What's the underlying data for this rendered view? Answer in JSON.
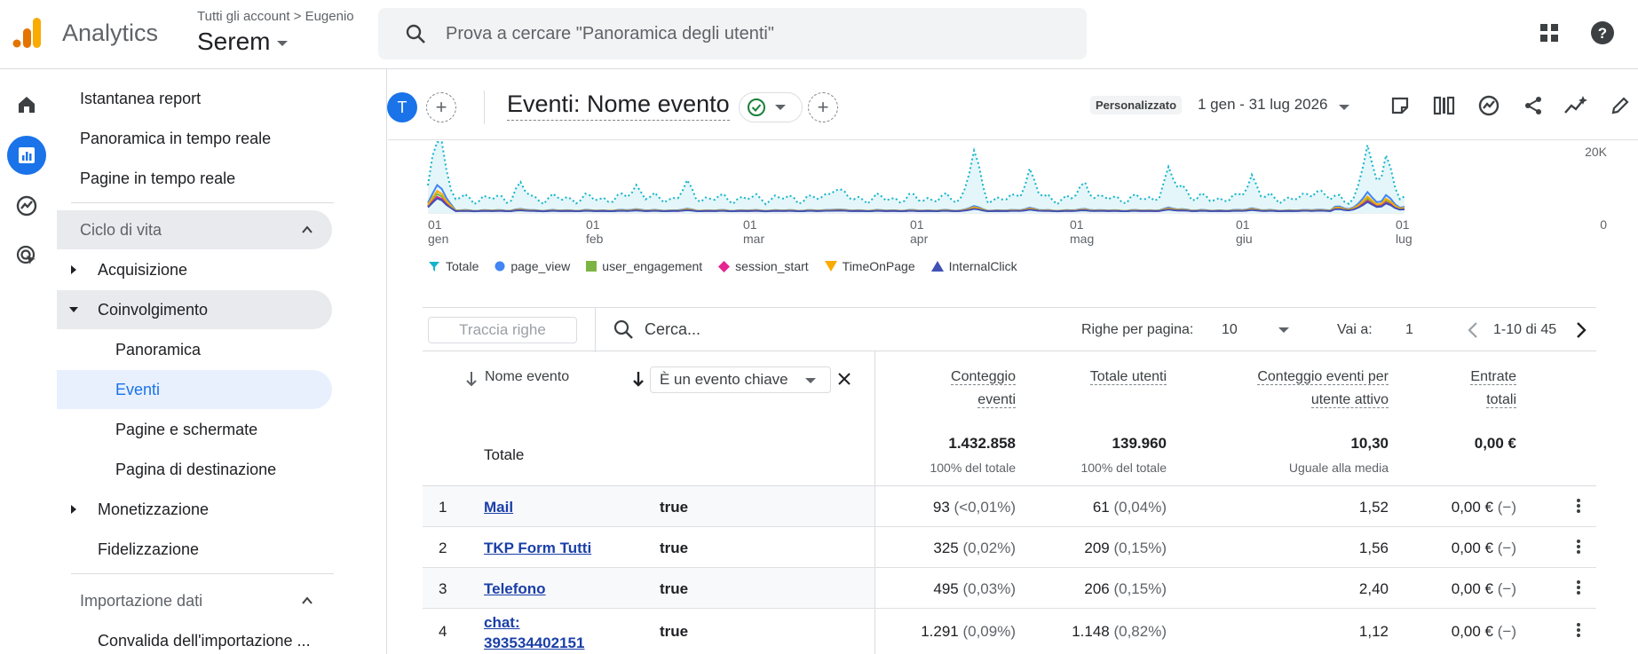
{
  "app": {
    "name": "Analytics"
  },
  "account": {
    "breadcrumb": "Tutti gli account > Eugenio",
    "property": "Serem"
  },
  "search": {
    "placeholder": "Prova a cercare \"Panoramica degli utenti\""
  },
  "sidebar": {
    "items": [
      {
        "label": "Istantanea report"
      },
      {
        "label": "Panoramica in tempo reale"
      },
      {
        "label": "Pagine in tempo reale"
      },
      {
        "label": "Ciclo di vita"
      },
      {
        "label": "Acquisizione"
      },
      {
        "label": "Coinvolgimento"
      },
      {
        "label": "Panoramica"
      },
      {
        "label": "Eventi"
      },
      {
        "label": "Pagine e schermate"
      },
      {
        "label": "Pagina di destinazione"
      },
      {
        "label": "Monetizzazione"
      },
      {
        "label": "Fidelizzazione"
      },
      {
        "label": "Importazione dati"
      },
      {
        "label": "Convalida dell'importazione ..."
      }
    ]
  },
  "report": {
    "avatar": "T",
    "title": "Eventi: Nome evento",
    "date_chip": "Personalizzato",
    "date_range": "1 gen - 31 lug 2026"
  },
  "chart_data": {
    "type": "line",
    "y_ticks": [
      "20K",
      "0"
    ],
    "x_ticks": [
      {
        "day": "01",
        "month": "gen"
      },
      {
        "day": "01",
        "month": "feb"
      },
      {
        "day": "01",
        "month": "mar"
      },
      {
        "day": "01",
        "month": "apr"
      },
      {
        "day": "01",
        "month": "mag"
      },
      {
        "day": "01",
        "month": "giu"
      },
      {
        "day": "01",
        "month": "lug"
      }
    ],
    "legend": [
      {
        "name": "Totale",
        "color": "#12b5cb"
      },
      {
        "name": "page_view",
        "color": "#4285f4"
      },
      {
        "name": "user_engagement",
        "color": "#7cb342"
      },
      {
        "name": "session_start",
        "color": "#e52592"
      },
      {
        "name": "TimeOnPage",
        "color": "#f9ab00"
      },
      {
        "name": "InternalClick",
        "color": "#3f51b5"
      }
    ]
  },
  "table": {
    "track_rows": "Traccia righe",
    "search_placeholder": "Cerca...",
    "rows_per_page_label": "Righe per pagina:",
    "rows_per_page": "10",
    "goto_label": "Vai a:",
    "goto_value": "1",
    "range": "1-10 di 45",
    "col_name": "Nome evento",
    "filter": "È un evento chiave",
    "headers": {
      "count": [
        "Conteggio",
        "eventi"
      ],
      "users": [
        "Totale utenti"
      ],
      "per_user": [
        "Conteggio eventi per",
        "utente attivo"
      ],
      "revenue": [
        "Entrate",
        "totali"
      ]
    },
    "totals": {
      "label": "Totale",
      "count": "1.432.858",
      "count_sub": "100% del totale",
      "users": "139.960",
      "users_sub": "100% del totale",
      "per_user": "10,30",
      "per_user_sub": "Uguale alla media",
      "revenue": "0,00 €"
    },
    "rows": [
      {
        "idx": "1",
        "name": "Mail",
        "name2": "",
        "key": "true",
        "count": "93",
        "count_pct": "(<0,01%)",
        "users": "61",
        "users_pct": "(0,04%)",
        "per_user": "1,52",
        "revenue": "0,00 €",
        "revenue_pct": "(−)"
      },
      {
        "idx": "2",
        "name": "TKP Form Tutti",
        "name2": "",
        "key": "true",
        "count": "325",
        "count_pct": "(0,02%)",
        "users": "209",
        "users_pct": "(0,15%)",
        "per_user": "1,56",
        "revenue": "0,00 €",
        "revenue_pct": "(−)"
      },
      {
        "idx": "3",
        "name": "Telefono",
        "name2": "",
        "key": "true",
        "count": "495",
        "count_pct": "(0,03%)",
        "users": "206",
        "users_pct": "(0,15%)",
        "per_user": "2,40",
        "revenue": "0,00 €",
        "revenue_pct": "(−)"
      },
      {
        "idx": "4",
        "name": "chat:",
        "name2": "393534402151",
        "key": "true",
        "count": "1.291",
        "count_pct": "(0,09%)",
        "users": "1.148",
        "users_pct": "(0,82%)",
        "per_user": "1,12",
        "revenue": "0,00 €",
        "revenue_pct": "(−)"
      }
    ]
  }
}
